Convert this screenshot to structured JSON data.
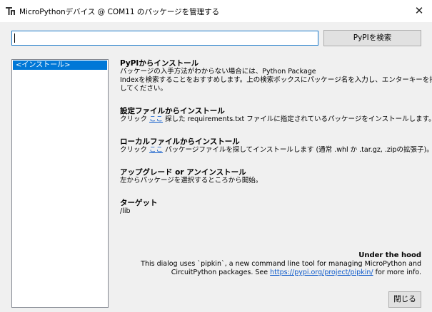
{
  "window": {
    "title": "MicroPythonデバイス @ COM11 のパッケージを管理する",
    "close_glyph": "✕"
  },
  "search": {
    "value": "",
    "button_label": "PyPIを検索"
  },
  "sidebar": {
    "items": [
      {
        "label": "<インストール>",
        "selected": true
      }
    ]
  },
  "sections": {
    "pypi": {
      "title": "PyPIからインストール",
      "line1": "パッケージの入手方法がわからない場合には、Python Package",
      "line2": "Indexを検索することをおすすめします。上の検索ボックスにパッケージ名を入力し、エンターキーを押",
      "line3": "してください。"
    },
    "requirements": {
      "title": "設定ファイルからインストール",
      "prefix": "クリック",
      "link": "ここ",
      "suffix": "探した requirements.txt ファイルに指定されているパッケージをインストールします。"
    },
    "local": {
      "title": "ローカルファイルからインストール",
      "prefix": "クリック",
      "link": "ここ",
      "suffix": "パッケージファイルを探してインストールします (通常 .whl か .tar.gz, .zipの拡張子)。"
    },
    "upgrade": {
      "title": "アップグレード or アンインストール",
      "body": "左からパッケージを選択するところから開始。"
    },
    "target": {
      "title": "ターゲット",
      "body": "/lib"
    }
  },
  "hood": {
    "title": "Under the hood",
    "line1": "This dialog uses `pipkin`, a new command line tool for managing MicroPython and",
    "line2_prefix": "CircuitPython packages. See",
    "link": "https://pypi.org/project/pipkin/",
    "line2_suffix": "for more info."
  },
  "footer": {
    "close_label": "閉じる"
  }
}
